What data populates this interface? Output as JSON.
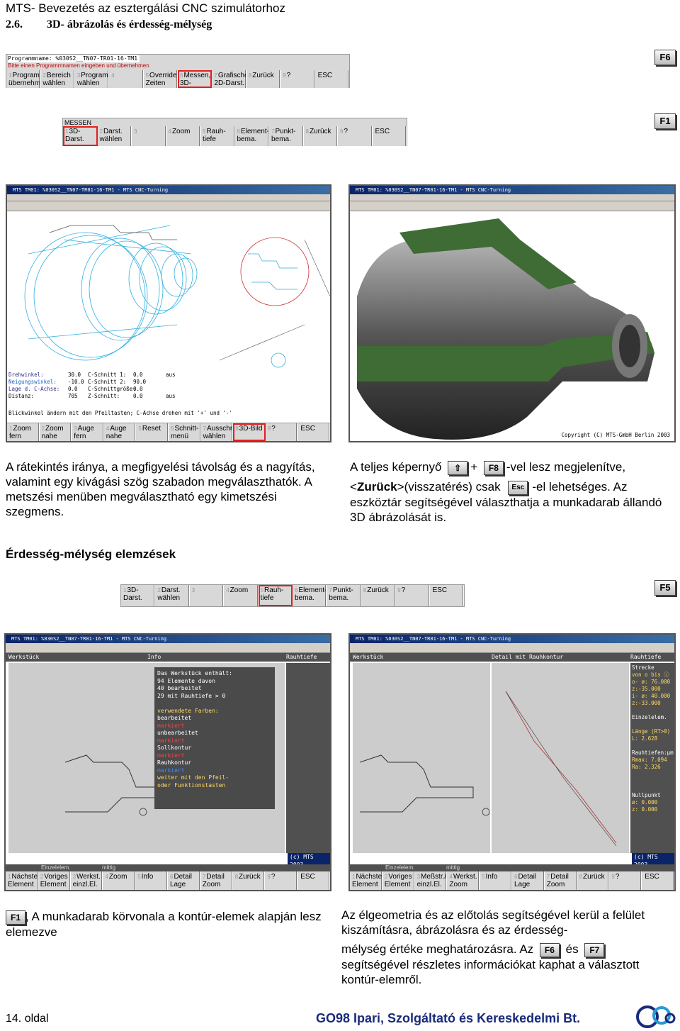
{
  "header": {
    "title": "MTS- Bevezetés az esztergálási CNC szimulátorhoz",
    "section_num": "2.6.",
    "section_title": "3D- ábrázolás és érdesség-mélység"
  },
  "fkeys": {
    "f6": "F6",
    "f1": "F1",
    "f5": "F5",
    "f8": "F8",
    "shift": "⇧",
    "esc": "Esc",
    "f7": "F7"
  },
  "toolbar1": {
    "line1": "Programmname: %030S2__TN07-TR01-16-TM1",
    "line2": "Bitte einen Programmnamen eingeben und übernehmen",
    "cells": [
      {
        "n": "1",
        "label": "Programm übernehmen"
      },
      {
        "n": "2",
        "label": "Bereich wählen"
      },
      {
        "n": "3",
        "label": "Programm wählen"
      },
      {
        "n": "4",
        "label": ""
      },
      {
        "n": "5",
        "label": "Override, Zeiten"
      },
      {
        "n": "6",
        "label": "Messen, 3D-Werkst"
      },
      {
        "n": "7",
        "label": "Grafische 2D-Darst."
      },
      {
        "n": "8",
        "label": "Zurück"
      },
      {
        "n": "9",
        "label": "?"
      },
      {
        "n": "",
        "label": "ESC"
      }
    ]
  },
  "toolbar2": {
    "heading": "MESSEN",
    "cells": [
      {
        "n": "1",
        "label": "3D- Darst."
      },
      {
        "n": "2",
        "label": "Darst. wählen"
      },
      {
        "n": "3",
        "label": ""
      },
      {
        "n": "4",
        "label": "Zoom"
      },
      {
        "n": "5",
        "label": "Rauh- tiefe"
      },
      {
        "n": "6",
        "label": "Element- bema."
      },
      {
        "n": "7",
        "label": "Punkt- bema."
      },
      {
        "n": "8",
        "label": "Zurück"
      },
      {
        "n": "9",
        "label": "?"
      },
      {
        "n": "",
        "label": "ESC"
      }
    ]
  },
  "shot_title": "MTS TM01: %030S2__TN07-TR01-16-TM1 - MTS CNC-Turning",
  "shot1": {
    "info": [
      [
        "Drehwinkel:",
        "30.0",
        "C-Schnitt 1:",
        "0.0",
        "aus"
      ],
      [
        "Neigungswinkel:",
        "-10.0",
        "C-Schnitt 2:",
        "90.0",
        ""
      ],
      [
        "Lage d. C-Achse:",
        "0.0",
        "C-Schnittgröße:",
        "0.0",
        ""
      ],
      [
        "Distanz:",
        "705",
        "Z-Schnitt:",
        "0.0",
        "aus"
      ]
    ],
    "hint": "Blickwinkel ändern mit den Pfeiltasten; C-Achse drehen mit '+' und '-'",
    "cells": [
      {
        "n": "1",
        "label": "Zoom fern"
      },
      {
        "n": "2",
        "label": "Zoom nahe"
      },
      {
        "n": "3",
        "label": "Auge fern"
      },
      {
        "n": "4",
        "label": "Auge nahe"
      },
      {
        "n": "5",
        "label": "Reset"
      },
      {
        "n": "6",
        "label": "Schnitt- menü"
      },
      {
        "n": "7",
        "label": "Ausschn. wählen"
      },
      {
        "n": "8",
        "label": "3D-Bild"
      },
      {
        "n": "9",
        "label": "?"
      },
      {
        "n": "",
        "label": "ESC"
      }
    ]
  },
  "shot2": {
    "copyright": "Copyright (C) MTS-GmbH Berlin 2003"
  },
  "text_left1": "A rátekintés iránya, a megfigyelési távolság és a nagyítás, valamint egy kivágási szög szabadon megválaszthatók. A metszési menüben megválasztható egy kimetszési szegmens.",
  "text_right1": {
    "p1": "A teljes képernyő",
    "plus": "+",
    "p2": "-vel lesz megjelenítve,",
    "zur_open": "<",
    "zur_bold": "Zurück",
    "zur_close": ">",
    "p3": "(visszatérés) csak",
    "p4": "-el lehetséges. Az eszköztár segítségével választhatja a munkadarab állandó 3D ábrázolását is."
  },
  "section2": "Érdesség-mélység elemzések",
  "toolbar3": {
    "cells": [
      {
        "n": "1",
        "label": "3D- Darst."
      },
      {
        "n": "2",
        "label": "Darst. wählen"
      },
      {
        "n": "3",
        "label": ""
      },
      {
        "n": "4",
        "label": "Zoom"
      },
      {
        "n": "5",
        "label": "Rauh- tiefe"
      },
      {
        "n": "6",
        "label": "Element- bema."
      },
      {
        "n": "7",
        "label": "Punkt- bema."
      },
      {
        "n": "8",
        "label": "Zurück"
      },
      {
        "n": "9",
        "label": "?"
      },
      {
        "n": "",
        "label": "ESC"
      }
    ]
  },
  "shot3": {
    "hdr_left": "Werkstück",
    "hdr_mid": "Info",
    "hdr_right": "Rauhtiefe",
    "info": [
      "Das Werkstück enthält:",
      "   94 Elemente davon",
      "   40 bearbeitet",
      "   29 mit Rauhtiefe > 0",
      "",
      "verwendete Farben:",
      "bearbeitet",
      "   markiert",
      "unbearbeitet",
      "   markiert",
      "Sollkontur",
      "   markiert",
      "Rauhkontur",
      "   markiert",
      "weiter mit den Pfeil-",
      "oder Funktionstasten"
    ],
    "copy": "(c) MTS 2003",
    "status": [
      "Einzelelem.",
      "mittig"
    ],
    "cells": [
      {
        "n": "1",
        "label": "Nächstes Element"
      },
      {
        "n": "2",
        "label": "Voriges Element"
      },
      {
        "n": "3",
        "label": "Werkst. einzl.El."
      },
      {
        "n": "4",
        "label": "Zoom"
      },
      {
        "n": "5",
        "label": "Info"
      },
      {
        "n": "6",
        "label": "Detail Lage"
      },
      {
        "n": "7",
        "label": "Detail Zoom"
      },
      {
        "n": "8",
        "label": "Zurück"
      },
      {
        "n": "9",
        "label": "?"
      },
      {
        "n": "",
        "label": "ESC"
      }
    ]
  },
  "shot4": {
    "hdr_left": "Werkstück",
    "hdr_mid": "Detail mit Rauhkontur",
    "hdr_right": "Rauhtiefe",
    "side": [
      "Strecke",
      "von o bis ⓘ",
      "o- ø: 76.000",
      "   z:-35.000",
      "i- ø: 40.000",
      "   z:-33.000",
      "",
      "Einzelelem.",
      "",
      "Länge (RT>0)",
      "L:  2.628",
      "",
      "Rauhtiefen:µm",
      "Rmax:  7.094",
      "Ra:  2.326",
      "",
      "",
      "",
      "Nullpunkt",
      "ø:  0.000",
      "z:  0.000"
    ],
    "copy": "(c) MTS 2003",
    "status": [
      "Einzelelem.",
      "mittig"
    ],
    "cells": [
      {
        "n": "1",
        "label": "Nächstes Element"
      },
      {
        "n": "2",
        "label": "Voriges Element"
      },
      {
        "n": "3",
        "label": "Meßstr./ einzl.El."
      },
      {
        "n": "4",
        "label": "Werkst. Zoom"
      },
      {
        "n": "5",
        "label": "Info"
      },
      {
        "n": "6",
        "label": "Detail Lage"
      },
      {
        "n": "7",
        "label": "Detail Zoom"
      },
      {
        "n": "8",
        "label": "Zurück"
      },
      {
        "n": "9",
        "label": "?"
      },
      {
        "n": "",
        "label": "ESC"
      }
    ]
  },
  "text_left2": ", A munkadarab körvonala a kontúr-elemek alapján lesz elemezve",
  "text_right2": {
    "p1": "Az élgeometria és az előtolás segítségével kerül a felület kiszámításra, ábrázolásra és az érdesség-",
    "p2": "mélység értéke meghatározásra. Az",
    "p3": "és",
    "p4": "segítségével részletes információkat kaphat a választott kontúr-elemről."
  },
  "footer": {
    "page": "14. oldal",
    "company": "GO98 Ipari, Szolgáltató és Kereskedelmi Bt.",
    "logo": "go98"
  }
}
